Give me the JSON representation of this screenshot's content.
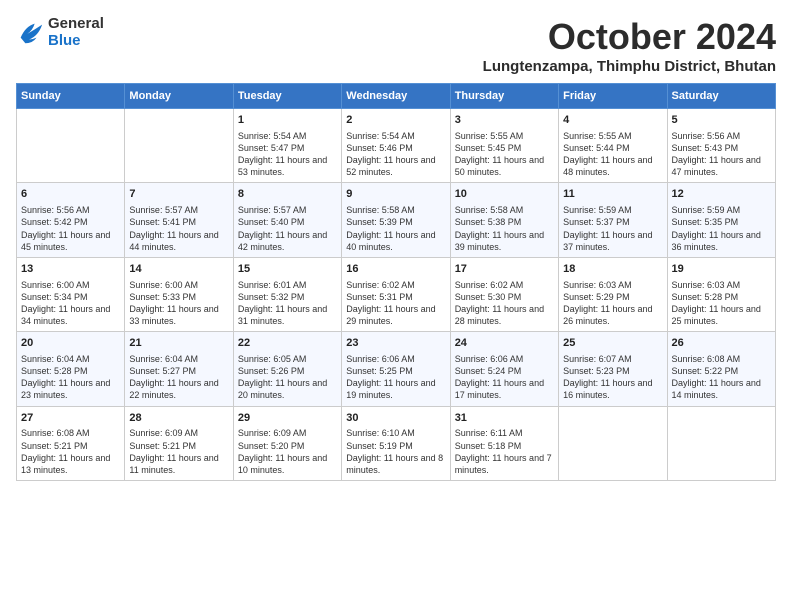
{
  "header": {
    "logo_line1": "General",
    "logo_line2": "Blue",
    "month": "October 2024",
    "location": "Lungtenzampa, Thimphu District, Bhutan"
  },
  "weekdays": [
    "Sunday",
    "Monday",
    "Tuesday",
    "Wednesday",
    "Thursday",
    "Friday",
    "Saturday"
  ],
  "weeks": [
    [
      {
        "day": "",
        "content": ""
      },
      {
        "day": "",
        "content": ""
      },
      {
        "day": "1",
        "content": "Sunrise: 5:54 AM\nSunset: 5:47 PM\nDaylight: 11 hours and 53 minutes."
      },
      {
        "day": "2",
        "content": "Sunrise: 5:54 AM\nSunset: 5:46 PM\nDaylight: 11 hours and 52 minutes."
      },
      {
        "day": "3",
        "content": "Sunrise: 5:55 AM\nSunset: 5:45 PM\nDaylight: 11 hours and 50 minutes."
      },
      {
        "day": "4",
        "content": "Sunrise: 5:55 AM\nSunset: 5:44 PM\nDaylight: 11 hours and 48 minutes."
      },
      {
        "day": "5",
        "content": "Sunrise: 5:56 AM\nSunset: 5:43 PM\nDaylight: 11 hours and 47 minutes."
      }
    ],
    [
      {
        "day": "6",
        "content": "Sunrise: 5:56 AM\nSunset: 5:42 PM\nDaylight: 11 hours and 45 minutes."
      },
      {
        "day": "7",
        "content": "Sunrise: 5:57 AM\nSunset: 5:41 PM\nDaylight: 11 hours and 44 minutes."
      },
      {
        "day": "8",
        "content": "Sunrise: 5:57 AM\nSunset: 5:40 PM\nDaylight: 11 hours and 42 minutes."
      },
      {
        "day": "9",
        "content": "Sunrise: 5:58 AM\nSunset: 5:39 PM\nDaylight: 11 hours and 40 minutes."
      },
      {
        "day": "10",
        "content": "Sunrise: 5:58 AM\nSunset: 5:38 PM\nDaylight: 11 hours and 39 minutes."
      },
      {
        "day": "11",
        "content": "Sunrise: 5:59 AM\nSunset: 5:37 PM\nDaylight: 11 hours and 37 minutes."
      },
      {
        "day": "12",
        "content": "Sunrise: 5:59 AM\nSunset: 5:35 PM\nDaylight: 11 hours and 36 minutes."
      }
    ],
    [
      {
        "day": "13",
        "content": "Sunrise: 6:00 AM\nSunset: 5:34 PM\nDaylight: 11 hours and 34 minutes."
      },
      {
        "day": "14",
        "content": "Sunrise: 6:00 AM\nSunset: 5:33 PM\nDaylight: 11 hours and 33 minutes."
      },
      {
        "day": "15",
        "content": "Sunrise: 6:01 AM\nSunset: 5:32 PM\nDaylight: 11 hours and 31 minutes."
      },
      {
        "day": "16",
        "content": "Sunrise: 6:02 AM\nSunset: 5:31 PM\nDaylight: 11 hours and 29 minutes."
      },
      {
        "day": "17",
        "content": "Sunrise: 6:02 AM\nSunset: 5:30 PM\nDaylight: 11 hours and 28 minutes."
      },
      {
        "day": "18",
        "content": "Sunrise: 6:03 AM\nSunset: 5:29 PM\nDaylight: 11 hours and 26 minutes."
      },
      {
        "day": "19",
        "content": "Sunrise: 6:03 AM\nSunset: 5:28 PM\nDaylight: 11 hours and 25 minutes."
      }
    ],
    [
      {
        "day": "20",
        "content": "Sunrise: 6:04 AM\nSunset: 5:28 PM\nDaylight: 11 hours and 23 minutes."
      },
      {
        "day": "21",
        "content": "Sunrise: 6:04 AM\nSunset: 5:27 PM\nDaylight: 11 hours and 22 minutes."
      },
      {
        "day": "22",
        "content": "Sunrise: 6:05 AM\nSunset: 5:26 PM\nDaylight: 11 hours and 20 minutes."
      },
      {
        "day": "23",
        "content": "Sunrise: 6:06 AM\nSunset: 5:25 PM\nDaylight: 11 hours and 19 minutes."
      },
      {
        "day": "24",
        "content": "Sunrise: 6:06 AM\nSunset: 5:24 PM\nDaylight: 11 hours and 17 minutes."
      },
      {
        "day": "25",
        "content": "Sunrise: 6:07 AM\nSunset: 5:23 PM\nDaylight: 11 hours and 16 minutes."
      },
      {
        "day": "26",
        "content": "Sunrise: 6:08 AM\nSunset: 5:22 PM\nDaylight: 11 hours and 14 minutes."
      }
    ],
    [
      {
        "day": "27",
        "content": "Sunrise: 6:08 AM\nSunset: 5:21 PM\nDaylight: 11 hours and 13 minutes."
      },
      {
        "day": "28",
        "content": "Sunrise: 6:09 AM\nSunset: 5:21 PM\nDaylight: 11 hours and 11 minutes."
      },
      {
        "day": "29",
        "content": "Sunrise: 6:09 AM\nSunset: 5:20 PM\nDaylight: 11 hours and 10 minutes."
      },
      {
        "day": "30",
        "content": "Sunrise: 6:10 AM\nSunset: 5:19 PM\nDaylight: 11 hours and 8 minutes."
      },
      {
        "day": "31",
        "content": "Sunrise: 6:11 AM\nSunset: 5:18 PM\nDaylight: 11 hours and 7 minutes."
      },
      {
        "day": "",
        "content": ""
      },
      {
        "day": "",
        "content": ""
      }
    ]
  ]
}
